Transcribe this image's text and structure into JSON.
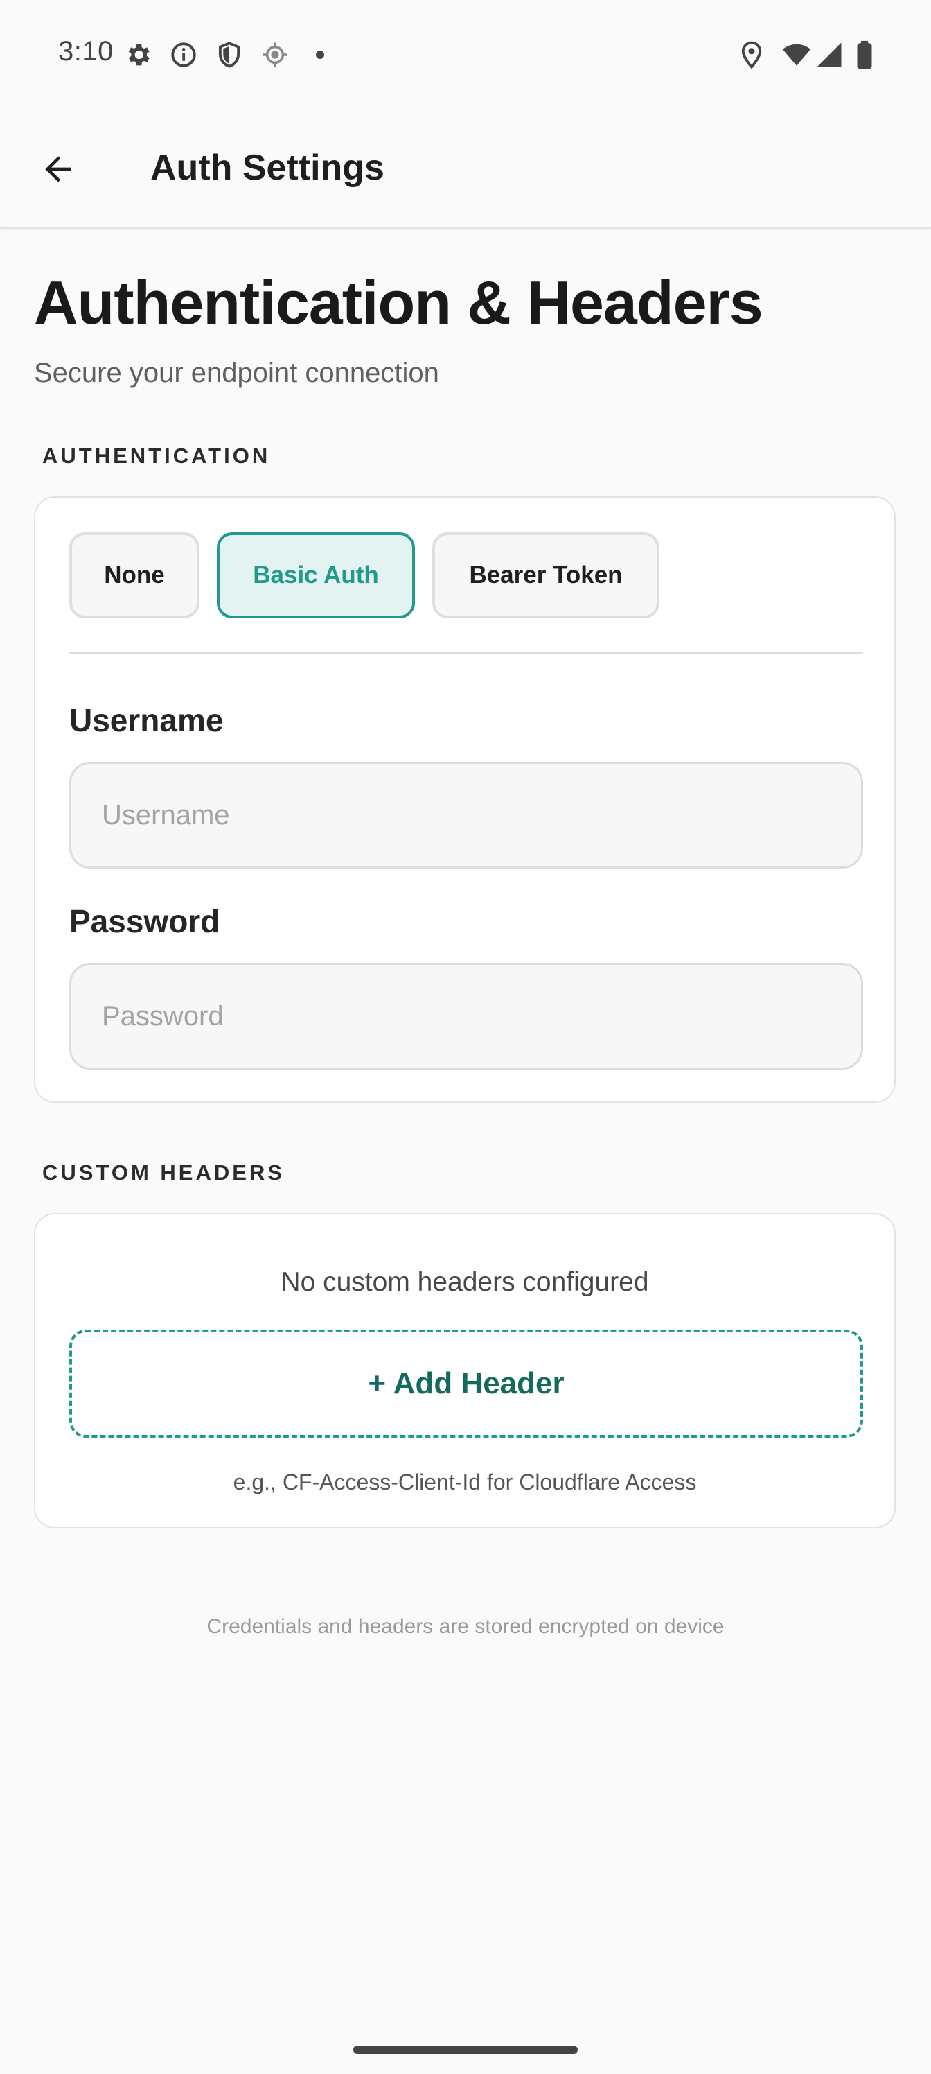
{
  "status_bar": {
    "time": "3:10",
    "left_icons": [
      "gear-icon",
      "info-icon",
      "shield-icon",
      "location-target-icon",
      "dot-icon"
    ],
    "right_icons": [
      "location-pin-icon",
      "wifi-icon",
      "cell-signal-icon",
      "battery-icon"
    ]
  },
  "app_bar": {
    "title": "Auth Settings",
    "back_icon": "arrow-left-icon"
  },
  "header": {
    "title": "Authentication & Headers",
    "subtitle": "Secure your endpoint connection"
  },
  "authentication": {
    "section_label": "AUTHENTICATION",
    "options": [
      {
        "label": "None",
        "selected": false
      },
      {
        "label": "Basic Auth",
        "selected": true
      },
      {
        "label": "Bearer Token",
        "selected": false
      }
    ],
    "username": {
      "label": "Username",
      "placeholder": "Username",
      "value": ""
    },
    "password": {
      "label": "Password",
      "placeholder": "Password",
      "value": ""
    }
  },
  "custom_headers": {
    "section_label": "CUSTOM HEADERS",
    "empty_text": "No custom headers configured",
    "add_button_label": "+ Add Header",
    "hint": "e.g., CF-Access-Client-Id for Cloudflare Access"
  },
  "footer": {
    "note": "Credentials and headers are stored encrypted on device"
  },
  "colors": {
    "accent": "#1f9a8c",
    "accent_dark": "#16695f",
    "accent_bg": "#e3f3f1",
    "background": "#fafafa"
  }
}
